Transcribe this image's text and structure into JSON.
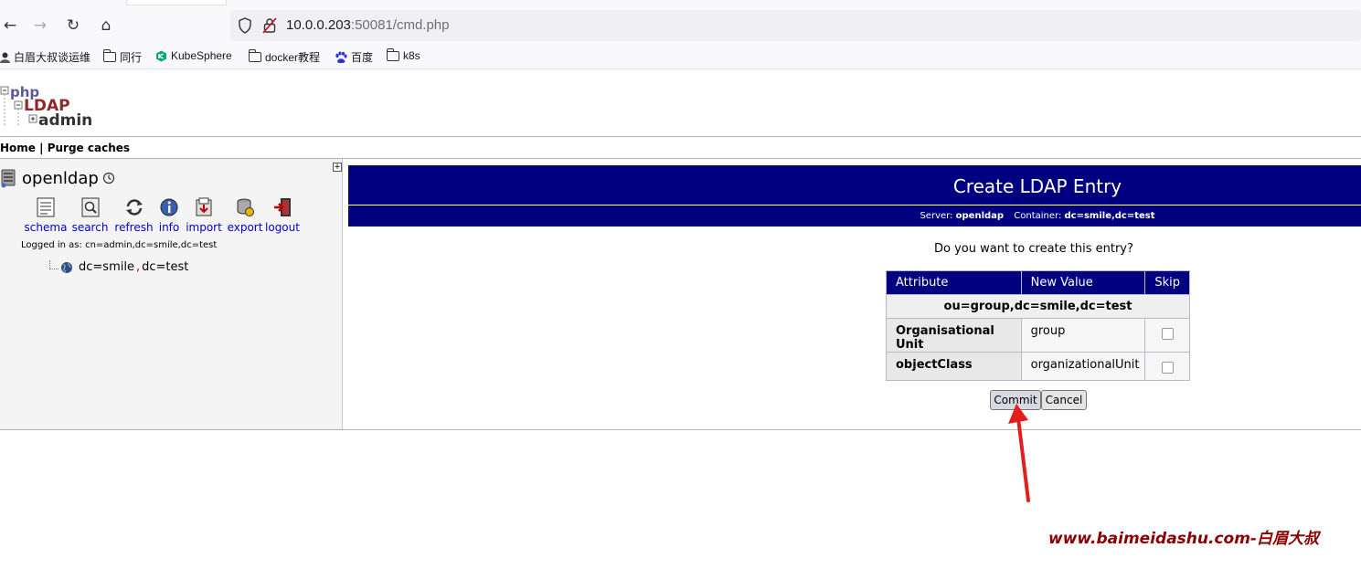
{
  "browser": {
    "url_host": "10.0.0.203",
    "url_rest": ":50081/cmd.php",
    "bookmarks": [
      "白眉大叔谈运维",
      "同行",
      "KubeSphere",
      "docker教程",
      "百度",
      "k8s"
    ]
  },
  "logo": {
    "line1": "php",
    "line2": "LDAP",
    "line3": "admin"
  },
  "topnav": {
    "home": "Home",
    "sep": "|",
    "purge": "Purge caches"
  },
  "sidebar": {
    "server_name": "openldap",
    "actions": [
      "schema",
      "search",
      "refresh",
      "info",
      "import",
      "export",
      "logout"
    ],
    "logged_in": "Logged in as: cn=admin,dc=smile,dc=test",
    "tree_item_a": "dc=smile",
    "tree_item_sep": ",",
    "tree_item_b": "dc=test"
  },
  "main": {
    "title": "Create LDAP Entry",
    "server_label": "Server:",
    "server_value": "openldap",
    "container_label": "Container:",
    "container_value": "dc=smile,dc=test",
    "question": "Do you want to create this entry?",
    "table": {
      "headers": [
        "Attribute",
        "New Value",
        "Skip"
      ],
      "dn": "ou=group,dc=smile,dc=test",
      "rows": [
        {
          "attr": "Organisational Unit",
          "value": "group"
        },
        {
          "attr": "objectClass",
          "value": "organizationalUnit"
        }
      ]
    },
    "commit_label": "Commit",
    "cancel_label": "Cancel"
  },
  "watermark": "www.baimeidashu.com-白眉大叔",
  "colors": {
    "header_bg": "#000080",
    "link": "#0000cc",
    "watermark": "#8b0000",
    "arrow": "#e02020"
  }
}
